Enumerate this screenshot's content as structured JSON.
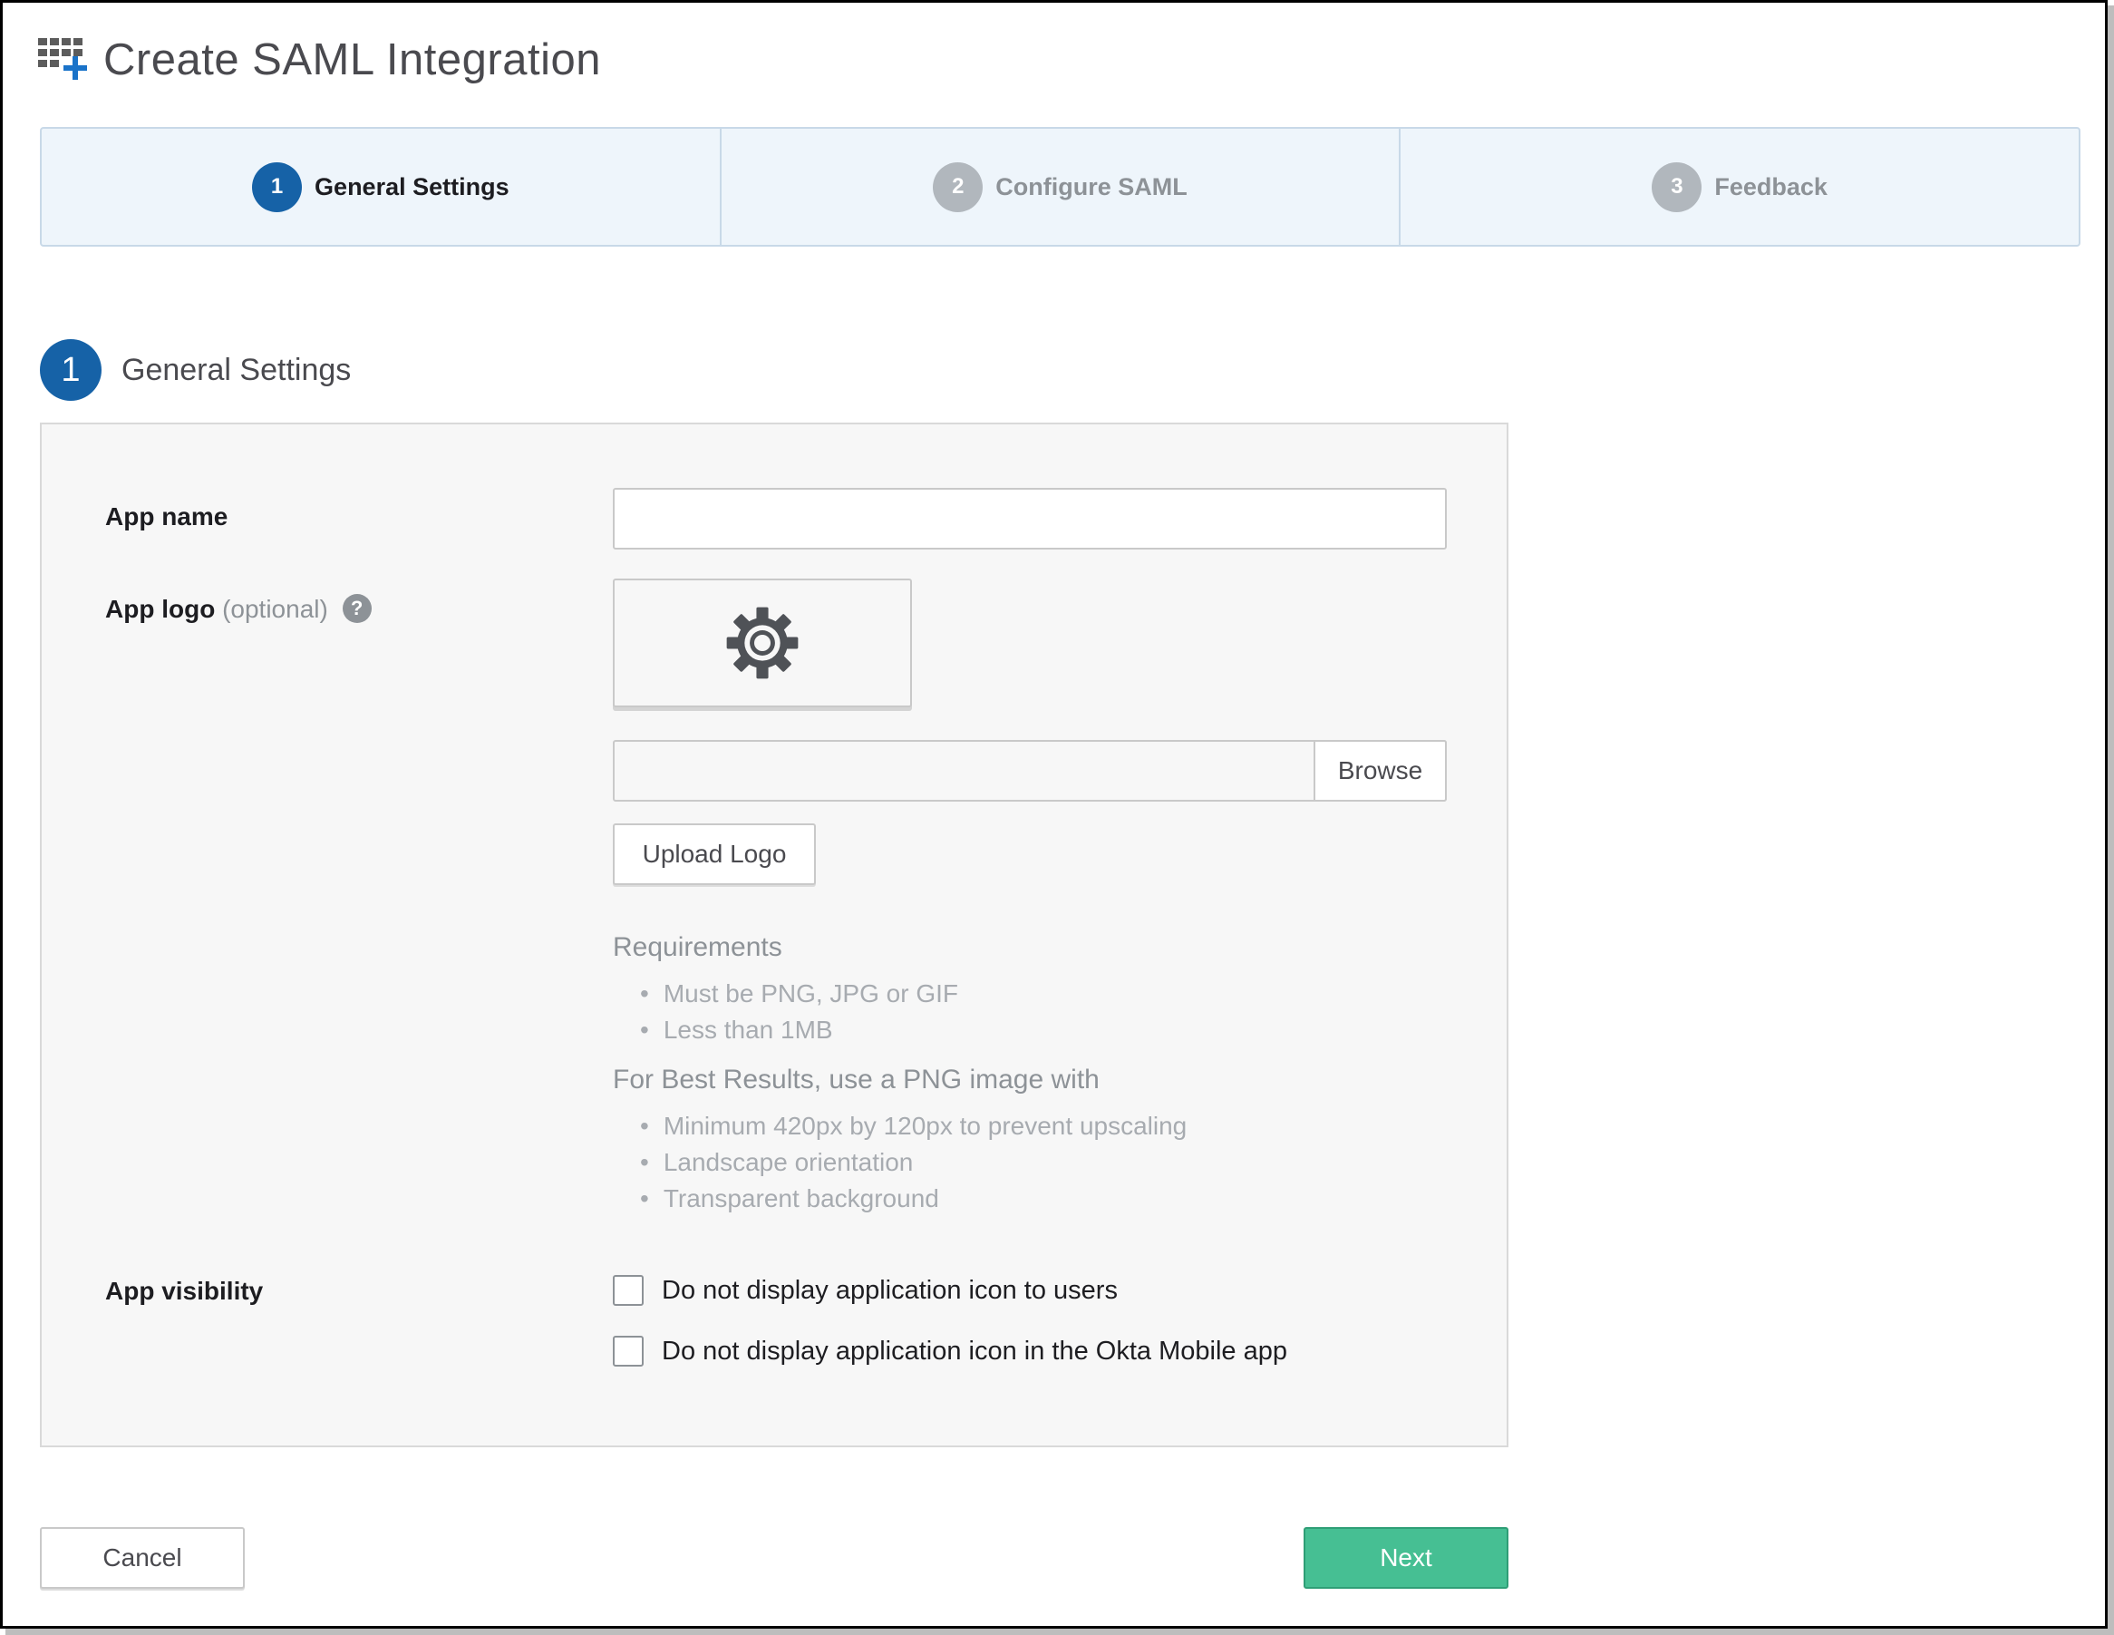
{
  "header": {
    "title": "Create SAML Integration",
    "icon": "add-app-grid-icon"
  },
  "stepper": {
    "steps": [
      {
        "number": "1",
        "label": "General Settings",
        "active": true
      },
      {
        "number": "2",
        "label": "Configure SAML",
        "active": false
      },
      {
        "number": "3",
        "label": "Feedback",
        "active": false
      }
    ]
  },
  "section": {
    "number": "1",
    "title": "General Settings"
  },
  "form": {
    "app_name_label": "App name",
    "app_name_value": "",
    "app_logo_label": "App logo",
    "app_logo_optional": "(optional)",
    "help_glyph": "?",
    "logo_placeholder_icon": "gear-icon",
    "file_value": "",
    "browse_label": "Browse",
    "upload_label": "Upload Logo",
    "requirements_heading": "Requirements",
    "requirements": [
      "Must be PNG, JPG or GIF",
      "Less than 1MB"
    ],
    "best_results_heading": "For Best Results, use a PNG image with",
    "best_results": [
      "Minimum 420px by 120px to prevent upscaling",
      "Landscape orientation",
      "Transparent background"
    ],
    "app_visibility_label": "App visibility",
    "visibility_options": [
      {
        "label": "Do not display application icon to users",
        "checked": false
      },
      {
        "label": "Do not display application icon in the Okta Mobile app",
        "checked": false
      }
    ]
  },
  "footer": {
    "cancel_label": "Cancel",
    "next_label": "Next"
  },
  "colors": {
    "primary": "#1662a7",
    "success": "#46bf93",
    "stepper_bg": "#eef5fb",
    "panel_bg": "#f7f7f7"
  }
}
